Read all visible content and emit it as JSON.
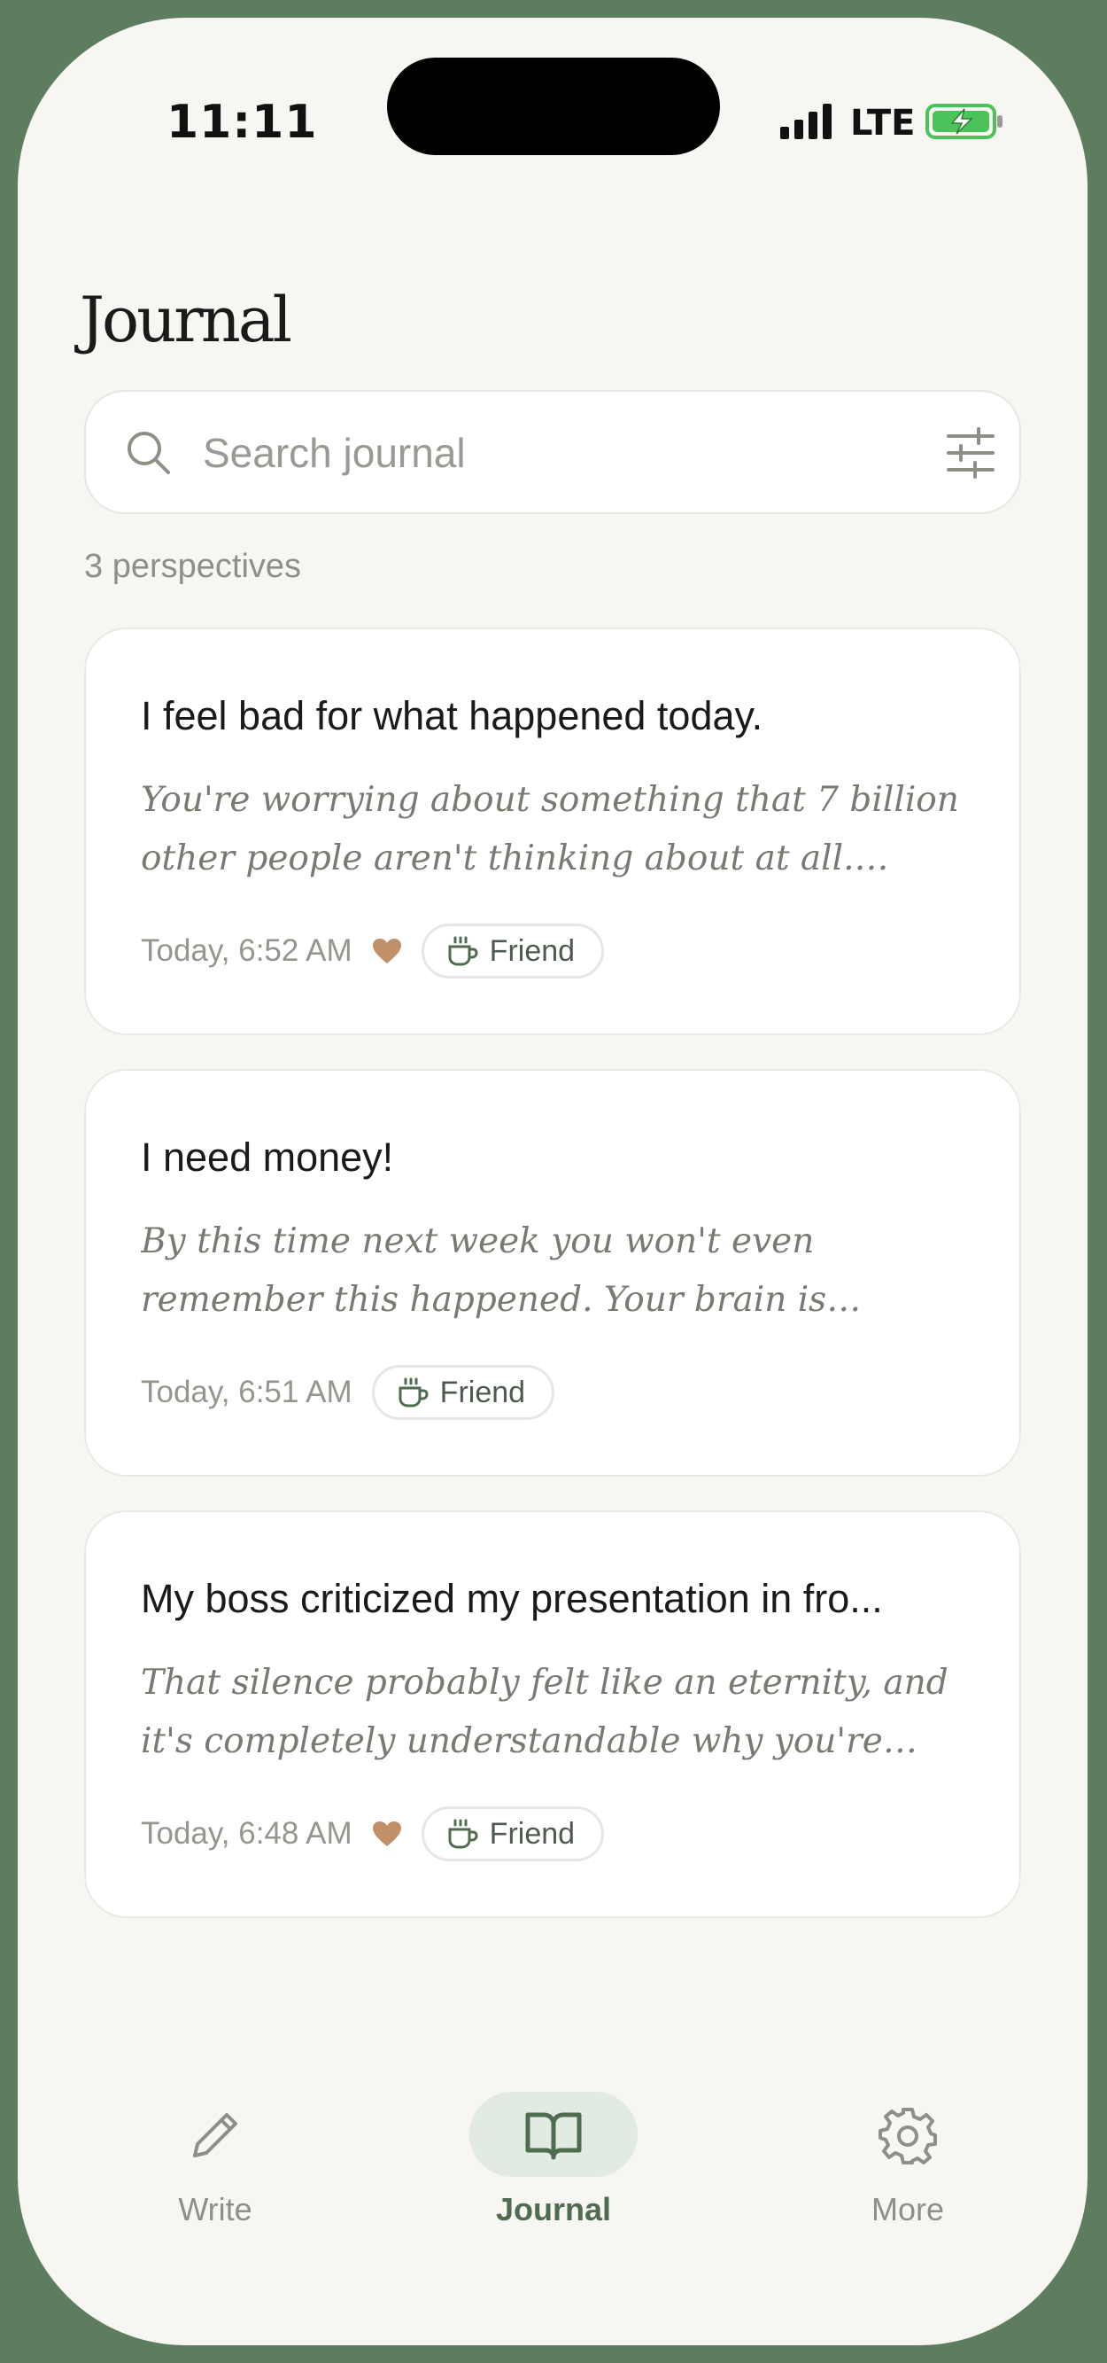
{
  "status_bar": {
    "time": "11:11",
    "network": "LTE"
  },
  "page": {
    "title": "Journal"
  },
  "search": {
    "placeholder": "Search journal"
  },
  "count_label": "3 perspectives",
  "entries": [
    {
      "title": "I feel bad for what happened today.",
      "preview": "You're worrying about something that 7 billion other people aren't thinking about at all. That...",
      "time": "Today, 6:52 AM",
      "favorited": true,
      "persona": "Friend"
    },
    {
      "title": "I need money!",
      "preview": "By this time next week you won't even remember this happened. Your brain is makin...",
      "time": "Today, 6:51 AM",
      "favorited": false,
      "persona": "Friend"
    },
    {
      "title": "My boss criticized my presentation in fro...",
      "preview": "That silence probably felt like an eternity, and it's completely understandable why you're rep...",
      "time": "Today, 6:48 AM",
      "favorited": true,
      "persona": "Friend"
    }
  ],
  "nav": {
    "items": [
      {
        "label": "Write",
        "icon": "pencil-icon",
        "active": false
      },
      {
        "label": "Journal",
        "icon": "book-icon",
        "active": true
      },
      {
        "label": "More",
        "icon": "gear-icon",
        "active": false
      }
    ]
  },
  "colors": {
    "frame": "#5e7d5f",
    "background": "#f7f6f3",
    "accent": "#4f6b50",
    "heart": "#c0906a",
    "battery": "#4cc35a"
  }
}
